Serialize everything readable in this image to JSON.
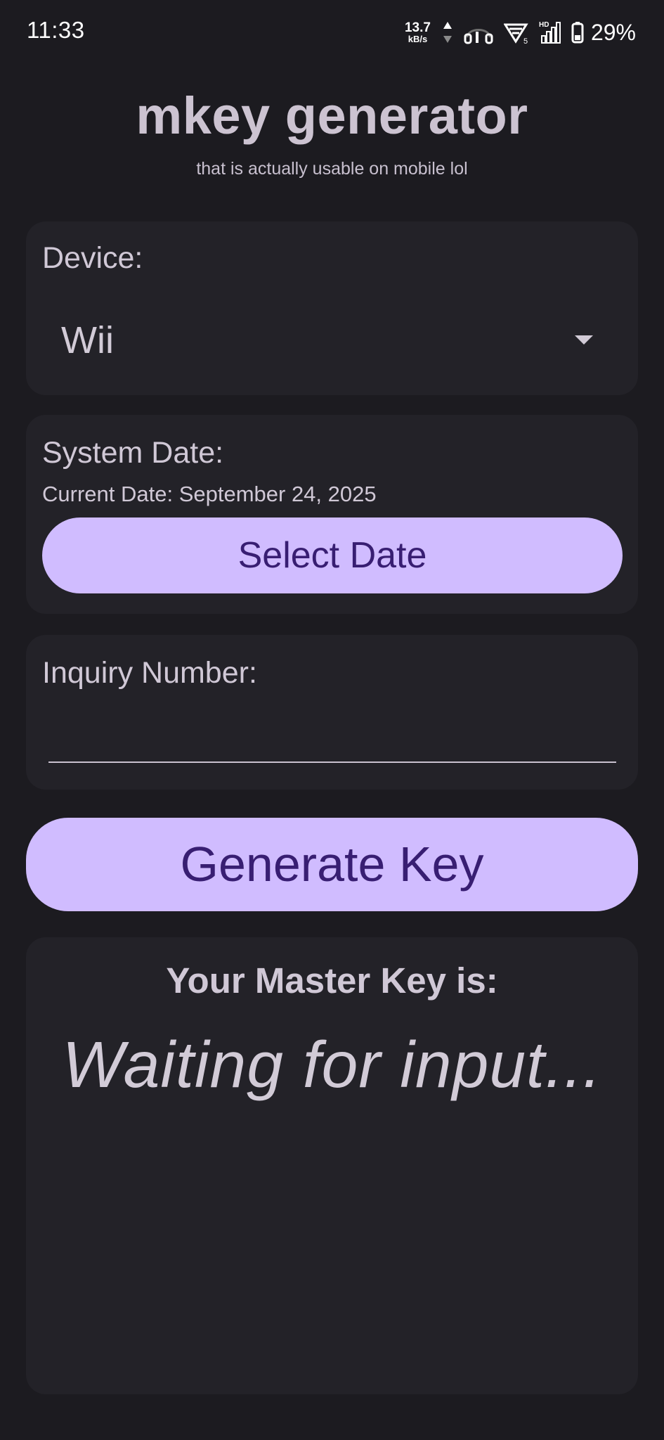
{
  "status_bar": {
    "time": "11:33",
    "network_speed_value": "13.7",
    "network_speed_unit": "kB/s",
    "signal_label": "HD",
    "battery_percent": "29%",
    "wifi_badge": "5"
  },
  "header": {
    "title": "mkey generator",
    "subtitle": "that is actually usable on mobile lol"
  },
  "device": {
    "label": "Device:",
    "selected": "Wii"
  },
  "system_date": {
    "label": "System Date:",
    "current_date": "Current Date: September 24, 2025",
    "select_button_label": "Select Date"
  },
  "inquiry": {
    "label": "Inquiry Number:",
    "value": ""
  },
  "generate_button_label": "Generate Key",
  "result": {
    "label": "Your Master Key is:",
    "value": "Waiting for input..."
  },
  "colors": {
    "background": "#1c1b20",
    "card": "#232228",
    "accent": "#d0bcff",
    "on_accent": "#381e72",
    "text": "#d0c8d6"
  }
}
